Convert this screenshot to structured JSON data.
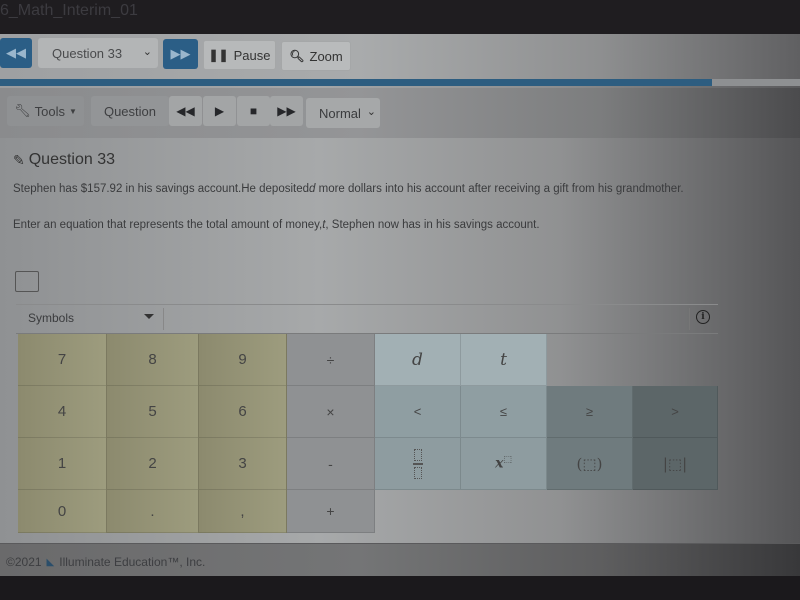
{
  "window": {
    "title": "6_Math_Interim_01"
  },
  "nav": {
    "prev_icon": "rewind-icon",
    "question_select": {
      "selected": "Question 33"
    },
    "next_icon": "fast-forward-icon",
    "pause_label": "Pause",
    "zoom_label": "Zoom",
    "progress_percent": 89
  },
  "toolbar": {
    "tools_label": "Tools",
    "question_label": "Question",
    "media": {
      "rewind": "⏪",
      "play": "▶",
      "stop": "■",
      "forward": "⏩"
    },
    "speed_select": {
      "selected": "Normal"
    }
  },
  "question": {
    "title": "Question 33",
    "text1_before": "Stephen has $157.92 in his savings account.He deposited",
    "text1_var": "d",
    "text1_after": " more dollars into his account after receiving a gift from his grandmother.",
    "text2_before": "Enter an equation that represents the total amount of money,",
    "text2_var": "t",
    "text2_after": ", Stephen now has in his savings account.",
    "answer_value": ""
  },
  "math_editor": {
    "symbols_label": "Symbols",
    "info_icon": "info-icon",
    "keys": {
      "k7": "7",
      "k8": "8",
      "k9": "9",
      "div": "÷",
      "k4": "4",
      "k5": "5",
      "k6": "6",
      "mul": "×",
      "k1": "1",
      "k2": "2",
      "k3": "3",
      "sub": "-",
      "k0": "0",
      "dot": ".",
      "comma": ",",
      "add": "+",
      "var_d": "d",
      "var_t": "t",
      "lt": "<",
      "le": "≤",
      "ge": "≥",
      "gt": ">",
      "pow_base": "x",
      "paren": "(⬚)",
      "abs": "|⬚|"
    }
  },
  "footer": {
    "copyright": "©2021",
    "company": "Illuminate Education™, Inc."
  },
  "colors": {
    "primary_blue": "#2b5e86",
    "progress": "#2d5d80",
    "numpad": "#9d9c7e",
    "varpad": "#a2b0b4"
  }
}
